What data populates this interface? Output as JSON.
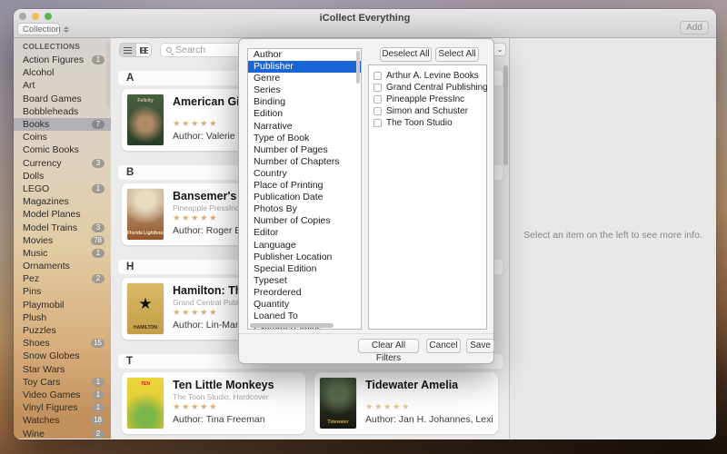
{
  "window": {
    "title": "iCollect Everything",
    "add_label": "Add",
    "collection_label": "Collection",
    "traffic_colors": {
      "close": "#a9a7a7",
      "minimize": "#f5bd4f",
      "zoom": "#56b94c"
    }
  },
  "sidebar": {
    "header": "COLLECTIONS",
    "items": [
      {
        "label": "Action Figures",
        "count": "1",
        "selected": false
      },
      {
        "label": "Alcohol",
        "count": "",
        "selected": false
      },
      {
        "label": "Art",
        "count": "",
        "selected": false
      },
      {
        "label": "Board Games",
        "count": "",
        "selected": false
      },
      {
        "label": "Bobbleheads",
        "count": "",
        "selected": false
      },
      {
        "label": "Books",
        "count": "7",
        "selected": true
      },
      {
        "label": "Coins",
        "count": "",
        "selected": false
      },
      {
        "label": "Comic Books",
        "count": "",
        "selected": false
      },
      {
        "label": "Currency",
        "count": "3",
        "selected": false
      },
      {
        "label": "Dolls",
        "count": "",
        "selected": false
      },
      {
        "label": "LEGO",
        "count": "1",
        "selected": false
      },
      {
        "label": "Magazines",
        "count": "",
        "selected": false
      },
      {
        "label": "Model Planes",
        "count": "",
        "selected": false
      },
      {
        "label": "Model Trains",
        "count": "3",
        "selected": false
      },
      {
        "label": "Movies",
        "count": "78",
        "selected": false
      },
      {
        "label": "Music",
        "count": "1",
        "selected": false
      },
      {
        "label": "Ornaments",
        "count": "",
        "selected": false
      },
      {
        "label": "Pez",
        "count": "2",
        "selected": false
      },
      {
        "label": "Pins",
        "count": "",
        "selected": false
      },
      {
        "label": "Playmobil",
        "count": "",
        "selected": false
      },
      {
        "label": "Plush",
        "count": "",
        "selected": false
      },
      {
        "label": "Puzzles",
        "count": "",
        "selected": false
      },
      {
        "label": "Shoes",
        "count": "15",
        "selected": false
      },
      {
        "label": "Snow Globes",
        "count": "",
        "selected": false
      },
      {
        "label": "Star Wars",
        "count": "",
        "selected": false
      },
      {
        "label": "Toy Cars",
        "count": "1",
        "selected": false
      },
      {
        "label": "Video Games",
        "count": "1",
        "selected": false
      },
      {
        "label": "Vinyl Figures",
        "count": "1",
        "selected": false
      },
      {
        "label": "Watches",
        "count": "18",
        "selected": false
      },
      {
        "label": "Wine",
        "count": "2",
        "selected": false
      }
    ]
  },
  "toolbar": {
    "search_placeholder": "Search",
    "sort_chevron": "⌄"
  },
  "list": {
    "star_glyphs": "★★★★★",
    "sections": [
      {
        "letter": "A",
        "cards": [
          {
            "title": "American Girl",
            "publisher": "",
            "author": "Author: Valerie Trip",
            "star_color": "#d9ad72",
            "cover": {
              "top": "#49603f",
              "bottom": "#273b28",
              "highlight": "#b08a64",
              "highlight_pos": "58%",
              "text": "Felicity",
              "text_color": "#d9c9a4",
              "text_pos": "top",
              "glyph": "",
              "glyph_color": ""
            }
          }
        ]
      },
      {
        "letter": "B",
        "cards": [
          {
            "title": "Bansemer's B",
            "publisher": "Pineapple PressInc",
            "author": "Author: Roger Ban",
            "star_color": "#d9ad72",
            "cover": {
              "top": "#c7b394",
              "bottom": "#93552b",
              "highlight": "#e8dcc2",
              "highlight_pos": "22%",
              "text": "Florida Lighthouses",
              "text_color": "#f0e6c8",
              "text_pos": "bottom",
              "glyph": "",
              "glyph_color": ""
            }
          }
        ]
      },
      {
        "letter": "H",
        "cards": [
          {
            "title": "Hamilton: The",
            "publisher": "Grand Central Publishin",
            "author": "Author: Lin-Manuel",
            "star_color": "#d9ad72",
            "cover": {
              "top": "#d9b967",
              "bottom": "#c39e47",
              "highlight": "",
              "highlight_pos": "",
              "text": "HAMILTON",
              "text_color": "#33291a",
              "text_pos": "bottom",
              "glyph": "★",
              "glyph_color": "#171310"
            }
          }
        ]
      },
      {
        "letter": "T",
        "cards": [
          {
            "title": "Ten Little Monkeys",
            "publisher": "The Toon Studio, Hardcover",
            "author": "Author: Tina Freeman",
            "star_color": "#d9ad72",
            "cover": {
              "top": "#ecd63d",
              "bottom": "#d9c22e",
              "highlight": "#7ab648",
              "highlight_pos": "78%",
              "text": "TEN",
              "text_color": "#cc2222",
              "text_pos": "top",
              "glyph": "",
              "glyph_color": ""
            }
          },
          {
            "title": "Tidewater Amelia",
            "publisher": "",
            "author": "Author: Jan H. Johannes, Lexington Ve",
            "star_color": "#e3c598",
            "cover": {
              "top": "#3d4a35",
              "bottom": "#17150f",
              "highlight": "#5d6b4d",
              "highlight_pos": "30%",
              "text": "Tidewater",
              "text_color": "#c9a44a",
              "text_pos": "bottom",
              "glyph": "",
              "glyph_color": ""
            }
          }
        ]
      }
    ]
  },
  "detail": {
    "empty_message": "Select an item on the left to see more info."
  },
  "modal": {
    "fields": [
      "Author",
      "Publisher",
      "Genre",
      "Series",
      "Binding",
      "Edition",
      "Narrative",
      "Type of Book",
      "Number of Pages",
      "Number of Chapters",
      "Country",
      "Place of Printing",
      "Publication Date",
      "Photos By",
      "Number of Copies",
      "Editor",
      "Language",
      "Publisher Location",
      "Special Edition",
      "Typeset",
      "Preordered",
      "Quantity",
      "Loaned To",
      "Estimated Value"
    ],
    "selected_field": "Publisher",
    "selection_color": "#1a66d6",
    "deselect_all_label": "Deselect All",
    "select_all_label": "Select All",
    "options": [
      "Arthur A. Levine Books",
      "Grand Central Publishing",
      "Pineapple PressInc",
      "Simon and Schuster",
      "The Toon Studio"
    ],
    "clear_label": "Clear All Filters",
    "cancel_label": "Cancel",
    "save_label": "Save"
  }
}
